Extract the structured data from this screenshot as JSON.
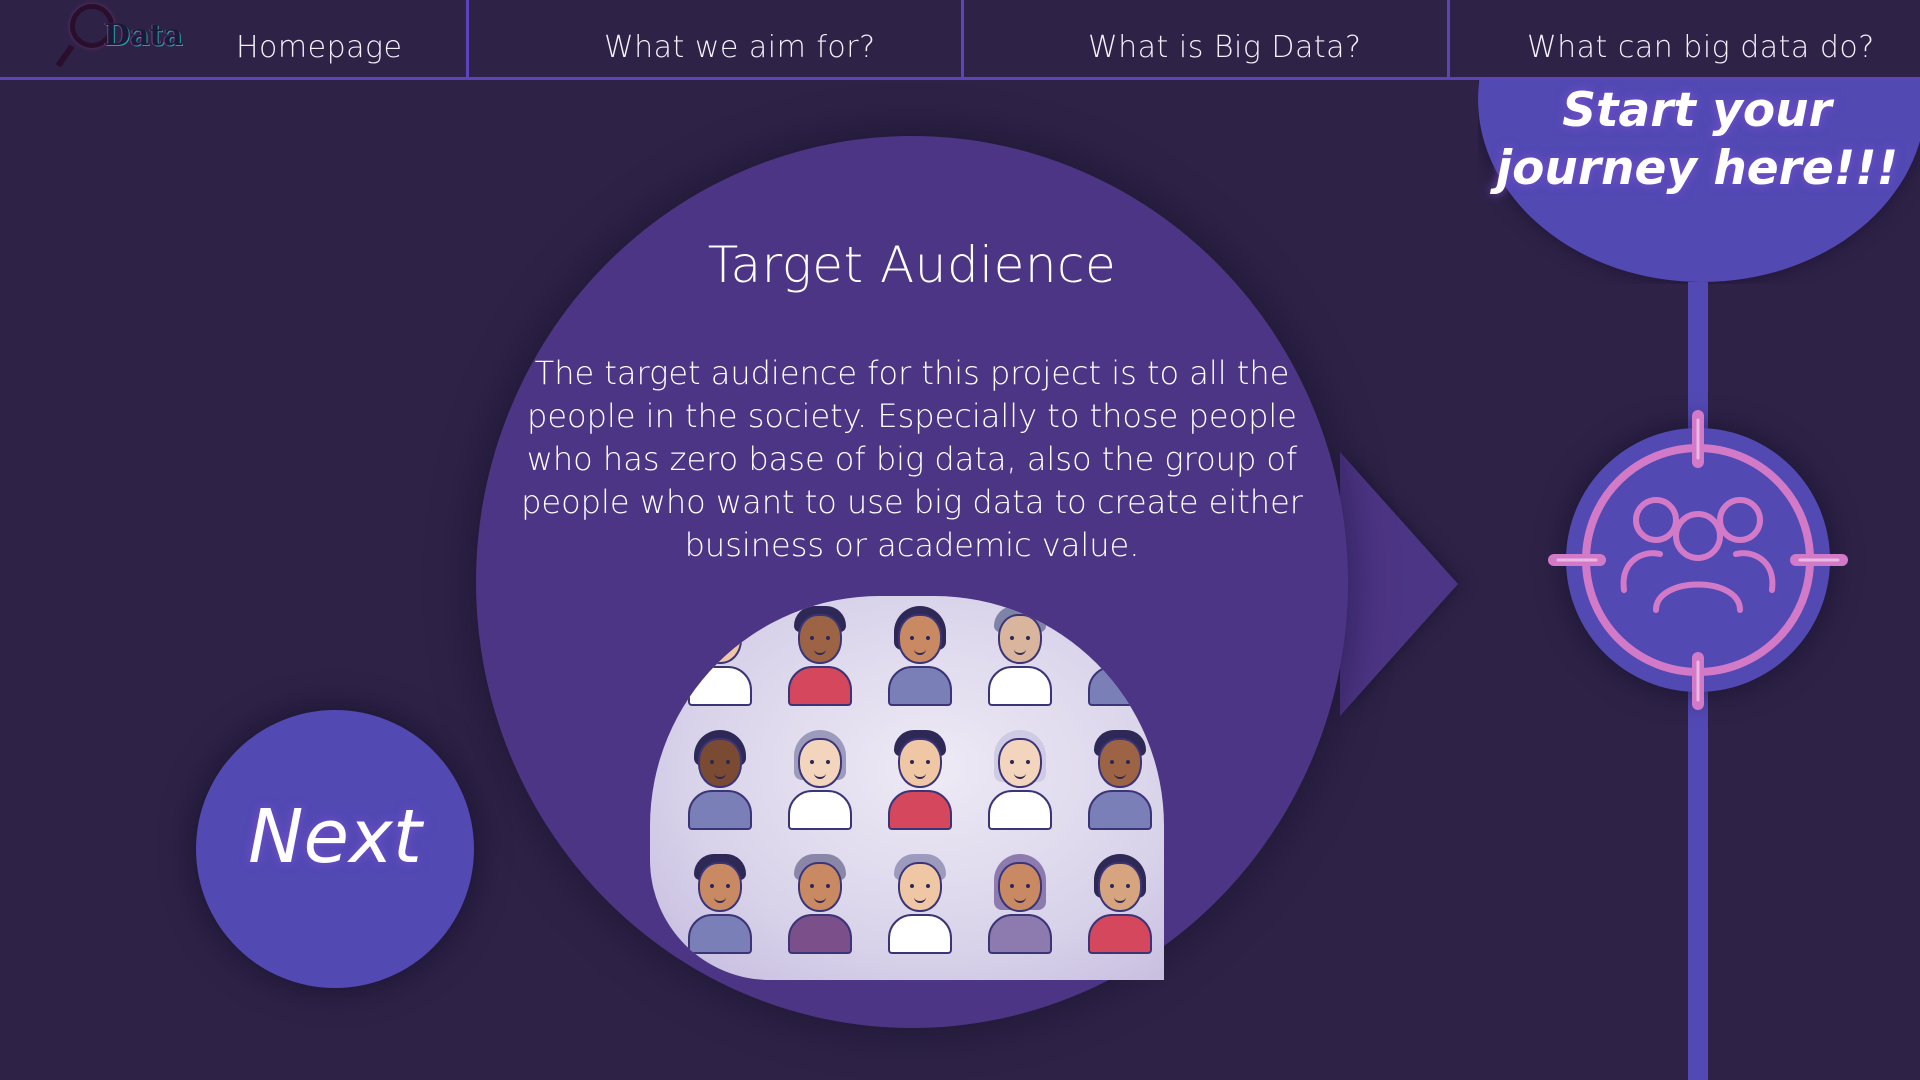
{
  "logo": {
    "text": "Data",
    "icon": "magnifier-logo-icon"
  },
  "nav": {
    "items": [
      {
        "label": "Homepage"
      },
      {
        "label": "What we aim for?"
      },
      {
        "label": "What is Big Data?"
      },
      {
        "label": "What can big data do?"
      }
    ]
  },
  "journey": {
    "text": "Start your journey here!!!"
  },
  "timeline": {
    "node_icon": "target-users-icon"
  },
  "content": {
    "title": "Target Audience",
    "body": "The target audience for this project is to all the people in the society. Especially to those people who has zero base of big data, also the group of people who want to use big data to create either business or academic value.",
    "image_icon": "people-avatars-grid"
  },
  "next_button": {
    "label": "Next"
  },
  "colors": {
    "background": "#2e2347",
    "accent": "#5249b3",
    "bubble": "#4d3585",
    "icon_pink": "#d27ac8"
  }
}
